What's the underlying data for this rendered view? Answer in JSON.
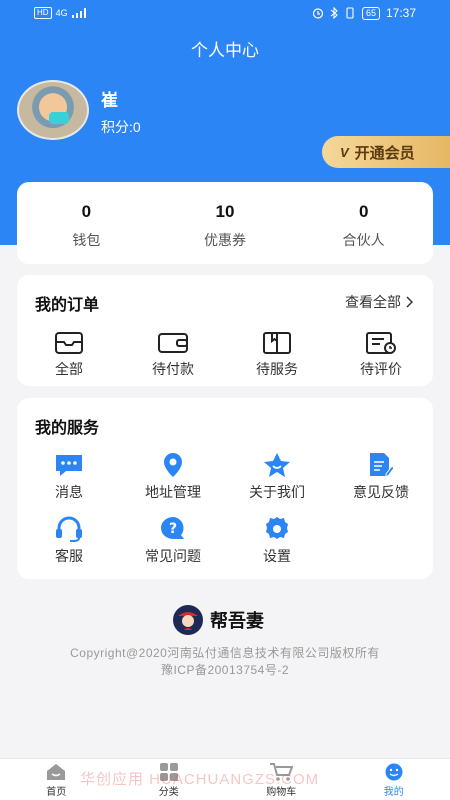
{
  "status_bar": {
    "network": "HD",
    "signal": "4G",
    "battery": "65",
    "time": "17:37"
  },
  "header": {
    "title": "个人中心"
  },
  "user": {
    "name": "崔",
    "points": "积分:0"
  },
  "vip": {
    "label": "开通会员",
    "icon_text": "V"
  },
  "stats": [
    {
      "value": "0",
      "label": "钱包"
    },
    {
      "value": "10",
      "label": "优惠券"
    },
    {
      "value": "0",
      "label": "合伙人"
    }
  ],
  "orders": {
    "title": "我的订单",
    "view_all": "查看全部",
    "items": [
      {
        "label": "全部",
        "icon": "inbox-icon"
      },
      {
        "label": "待付款",
        "icon": "wallet-icon"
      },
      {
        "label": "待服务",
        "icon": "book-icon"
      },
      {
        "label": "待评价",
        "icon": "review-icon"
      }
    ]
  },
  "services": {
    "title": "我的服务",
    "items": [
      {
        "label": "消息",
        "icon": "message-icon"
      },
      {
        "label": "地址管理",
        "icon": "location-icon"
      },
      {
        "label": "关于我们",
        "icon": "star-icon"
      },
      {
        "label": "意见反馈",
        "icon": "feedback-icon"
      },
      {
        "label": "客服",
        "icon": "headset-icon"
      },
      {
        "label": "常见问题",
        "icon": "question-icon"
      },
      {
        "label": "设置",
        "icon": "gear-icon"
      }
    ]
  },
  "brand": {
    "name": "帮吾妻"
  },
  "copyright": {
    "line1": "Copyright@2020河南弘付通信息技术有限公司版权所有",
    "line2": "豫ICP备20013754号-2"
  },
  "tabbar": [
    {
      "label": "首页",
      "icon": "home-icon"
    },
    {
      "label": "分类",
      "icon": "category-icon"
    },
    {
      "label": "购物车",
      "icon": "cart-icon"
    },
    {
      "label": "我的",
      "icon": "profile-icon"
    }
  ],
  "watermark": "华创应用 HUACHUANGZS.COM",
  "colors": {
    "primary": "#2c85f5",
    "vip_gold": "#e6b865",
    "background": "#f4f4f6"
  }
}
